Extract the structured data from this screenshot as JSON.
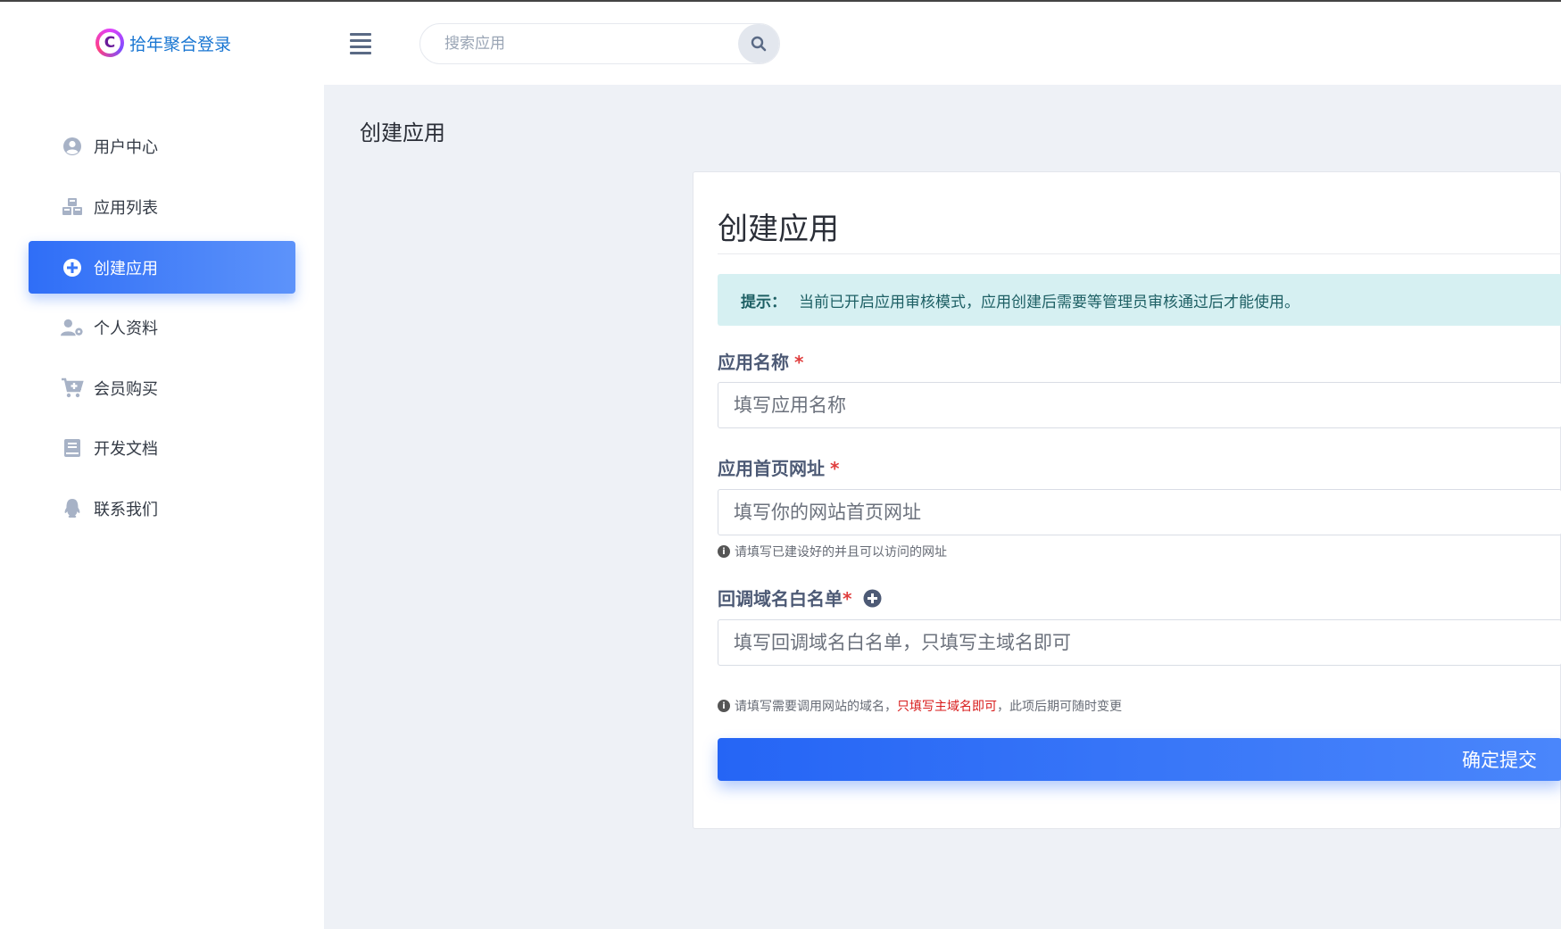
{
  "brand": {
    "name": "拾年聚合登录",
    "logo_letter": "C"
  },
  "search": {
    "placeholder": "搜索应用"
  },
  "sidebar": {
    "items": [
      {
        "label": "用户中心",
        "icon": "user-circle-icon",
        "active": false
      },
      {
        "label": "应用列表",
        "icon": "cubes-icon",
        "active": false
      },
      {
        "label": "创建应用",
        "icon": "plus-circle-icon",
        "active": true
      },
      {
        "label": "个人资料",
        "icon": "user-cog-icon",
        "active": false
      },
      {
        "label": "会员购买",
        "icon": "cart-plus-icon",
        "active": false
      },
      {
        "label": "开发文档",
        "icon": "book-icon",
        "active": false
      },
      {
        "label": "联系我们",
        "icon": "qq-icon",
        "active": false
      }
    ]
  },
  "main": {
    "page_title": "创建应用",
    "card": {
      "title": "创建应用",
      "alert": {
        "label": "提示：",
        "text": "当前已开启应用审核模式，应用创建后需要等管理员审核通过后才能使用。"
      },
      "fields": {
        "app_name": {
          "label": "应用名称",
          "required_mark": "*",
          "placeholder": "填写应用名称",
          "value": ""
        },
        "homepage": {
          "label": "应用首页网址",
          "required_mark": "*",
          "placeholder": "填写你的网站首页网址",
          "value": "",
          "help": "请填写已建设好的并且可以访问的网址"
        },
        "callback": {
          "label": "回调域名白名单",
          "required_mark": "*",
          "placeholder": "填写回调域名白名单，只填写主域名即可",
          "value": "",
          "help_prefix": "请填写需要调用网站的域名，",
          "help_highlight": "只填写主域名即可",
          "help_suffix": "，此项后期可随时变更"
        }
      },
      "submit_label": "确定提交"
    }
  },
  "colors": {
    "accent": "#2f6ef7",
    "alert_bg": "#d6f0f2",
    "alert_text": "#1d5f64",
    "required": "#e03e3e",
    "main_bg": "#eef1f6"
  }
}
